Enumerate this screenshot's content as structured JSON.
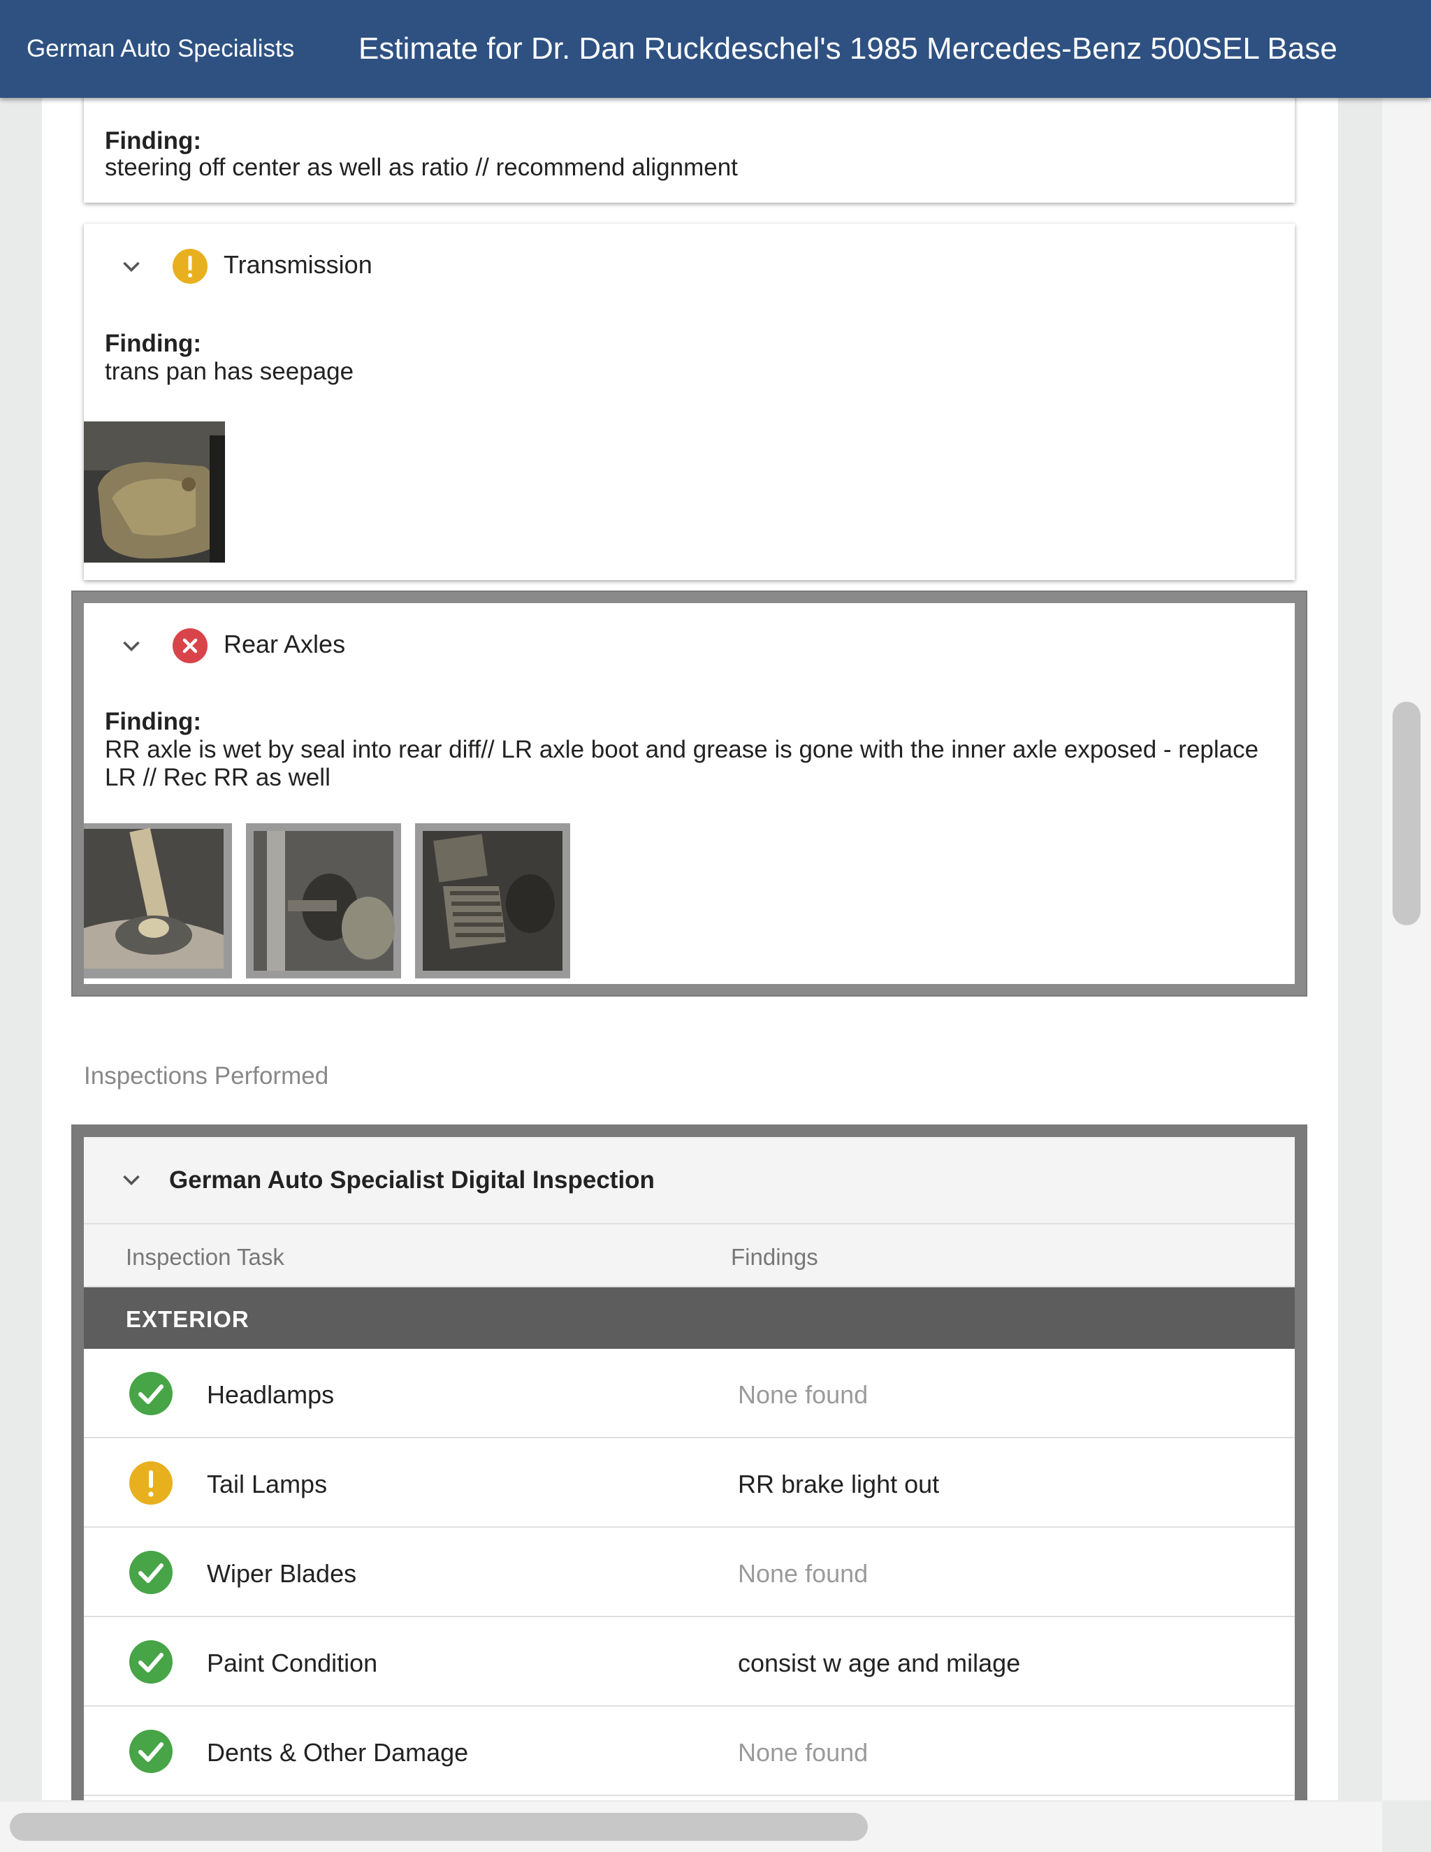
{
  "header": {
    "brand": "German Auto Specialists",
    "title": "Estimate for Dr. Dan Ruckdeschel's 1985 Mercedes-Benz 500SEL Base"
  },
  "colors": {
    "header_bg": "#2e5182",
    "warning": "#e8b01e",
    "fail": "#d9434a",
    "pass": "#47a447"
  },
  "steering_card": {
    "finding_label": "Finding:",
    "finding_text": "steering off center as well as ratio // recommend alignment"
  },
  "transmission_card": {
    "title": "Transmission",
    "status": "warning",
    "finding_label": "Finding:",
    "finding_text": "trans pan has seepage",
    "photo_count": 1
  },
  "rear_axles_card": {
    "title": "Rear Axles",
    "status": "fail",
    "finding_label": "Finding:",
    "finding_text": "RR axle is wet by seal into rear diff// LR axle boot and grease is gone with the inner axle exposed - replace LR // Rec RR as well",
    "photo_count": 3
  },
  "inspections": {
    "section_label": "Inspections Performed",
    "title": "German Auto Specialist Digital Inspection",
    "col_task": "Inspection Task",
    "col_findings": "Findings",
    "group": "EXTERIOR",
    "rows": [
      {
        "task": "Headlamps",
        "finding": "None found",
        "status": "pass"
      },
      {
        "task": "Tail Lamps",
        "finding": "RR brake light out",
        "status": "warning"
      },
      {
        "task": "Wiper Blades",
        "finding": "None found",
        "status": "pass"
      },
      {
        "task": "Paint Condition",
        "finding": "consist w age and milage",
        "status": "pass"
      },
      {
        "task": "Dents & Other Damage",
        "finding": "None found",
        "status": "pass"
      }
    ]
  }
}
